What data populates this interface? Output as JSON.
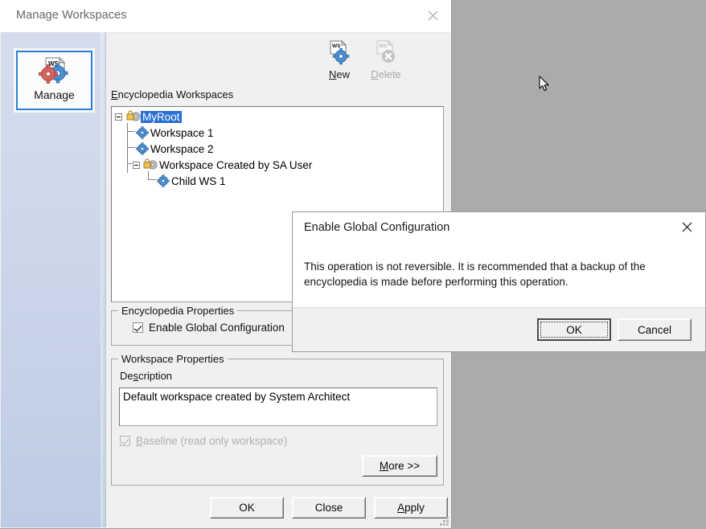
{
  "window": {
    "title": "Manage Workspaces",
    "close_icon": "close-icon"
  },
  "sidebar": {
    "items": [
      {
        "label": "Manage",
        "icon": "workspace-manage-icon",
        "selected": true
      }
    ]
  },
  "toolbar": {
    "buttons": [
      {
        "label": "New",
        "accel": "N",
        "icon": "new-workspace-icon",
        "enabled": true
      },
      {
        "label": "Delete",
        "accel": "D",
        "icon": "delete-workspace-icon",
        "enabled": false
      }
    ]
  },
  "tree": {
    "label": "Encyclopedia Workspaces",
    "label_accel": "E",
    "nodes": [
      {
        "text": "MyRoot",
        "depth": 0,
        "icon": "locked-workspace-icon",
        "expander": "minus",
        "selected": true
      },
      {
        "text": "Workspace 1",
        "depth": 1,
        "icon": "workspace-icon",
        "expander": "none",
        "selected": false
      },
      {
        "text": "Workspace 2",
        "depth": 1,
        "icon": "workspace-icon",
        "expander": "none",
        "selected": false
      },
      {
        "text": "Workspace Created by SA User",
        "depth": 1,
        "icon": "locked-workspace-icon",
        "expander": "minus",
        "selected": false
      },
      {
        "text": "Child WS 1",
        "depth": 2,
        "icon": "workspace-icon",
        "expander": "none",
        "selected": false
      }
    ]
  },
  "encyclopedia_properties": {
    "title": "Encyclopedia Properties",
    "checkbox": {
      "label": "Enable Global Configuration",
      "checked": true,
      "enabled": true
    }
  },
  "workspace_properties": {
    "title": "Workspace Properties",
    "description_label": "Description",
    "description_accel": "s",
    "description_value": "Default workspace created by System Architect",
    "baseline_checkbox": {
      "label": "Baseline (read only workspace)",
      "accel": "B",
      "checked": true,
      "enabled": false
    },
    "more_button": {
      "label": "More >>",
      "accel": "M"
    }
  },
  "footer": {
    "buttons": [
      {
        "label": "OK",
        "default": true
      },
      {
        "label": "Close",
        "default": false
      },
      {
        "label": "Apply",
        "accel": "A",
        "default": false
      }
    ]
  },
  "dialog": {
    "title": "Enable Global Configuration",
    "close_icon": "close-icon",
    "message": "This operation is not reversible. It is recommended that a backup of the encyclopedia is made before performing this operation.",
    "buttons": [
      {
        "label": "OK",
        "default": true,
        "focused": true
      },
      {
        "label": "Cancel",
        "default": false,
        "focused": false
      }
    ]
  },
  "cursor": {
    "icon": "mouse-pointer-icon"
  },
  "colors": {
    "desktop": "#ababab",
    "window_face": "#f0f0f0",
    "selection": "#2a6fd4",
    "sidebar_top": "#d5dded",
    "sidebar_bottom": "#bdcce4",
    "accent_border": "#2b7fd4"
  }
}
